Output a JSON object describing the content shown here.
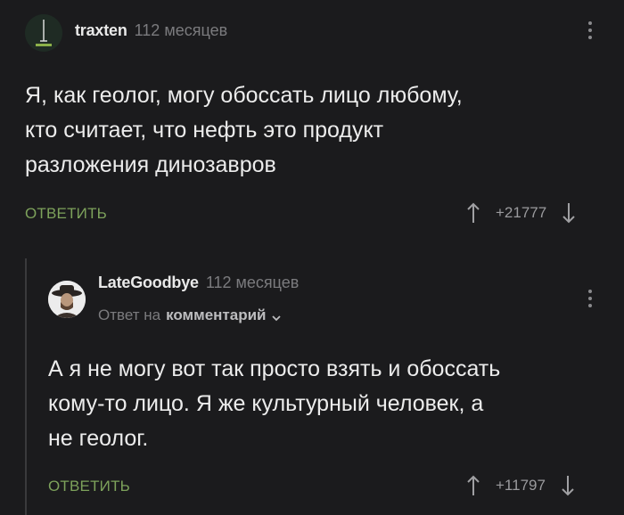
{
  "comments": [
    {
      "username": "traxten",
      "time": "112 месяцев",
      "text": "Я, как геолог, могу обоссать лицо любому,\nкто считает, что нефть это продукт\nразложения динозавров",
      "reply_label": "ОТВЕТИТЬ",
      "score": "+21777"
    },
    {
      "username": "LateGoodbye",
      "time": "112 месяцев",
      "reply_prefix": "Ответ на",
      "reply_link": "комментарий",
      "text": "А я не могу вот так просто взять и обоссать\nкому-то лицо. Я же культурный человек, а\nне геолог.",
      "reply_label": "ОТВЕТИТЬ",
      "score": "+11797"
    }
  ],
  "icons": {
    "upvote": "arrow-up-icon",
    "downvote": "arrow-down-icon",
    "more": "more-vertical-icon",
    "expand": "chevron-down-icon"
  },
  "colors": {
    "background": "#1b1b1d",
    "accent_green": "#7da25b",
    "muted": "#7b7b7e"
  }
}
